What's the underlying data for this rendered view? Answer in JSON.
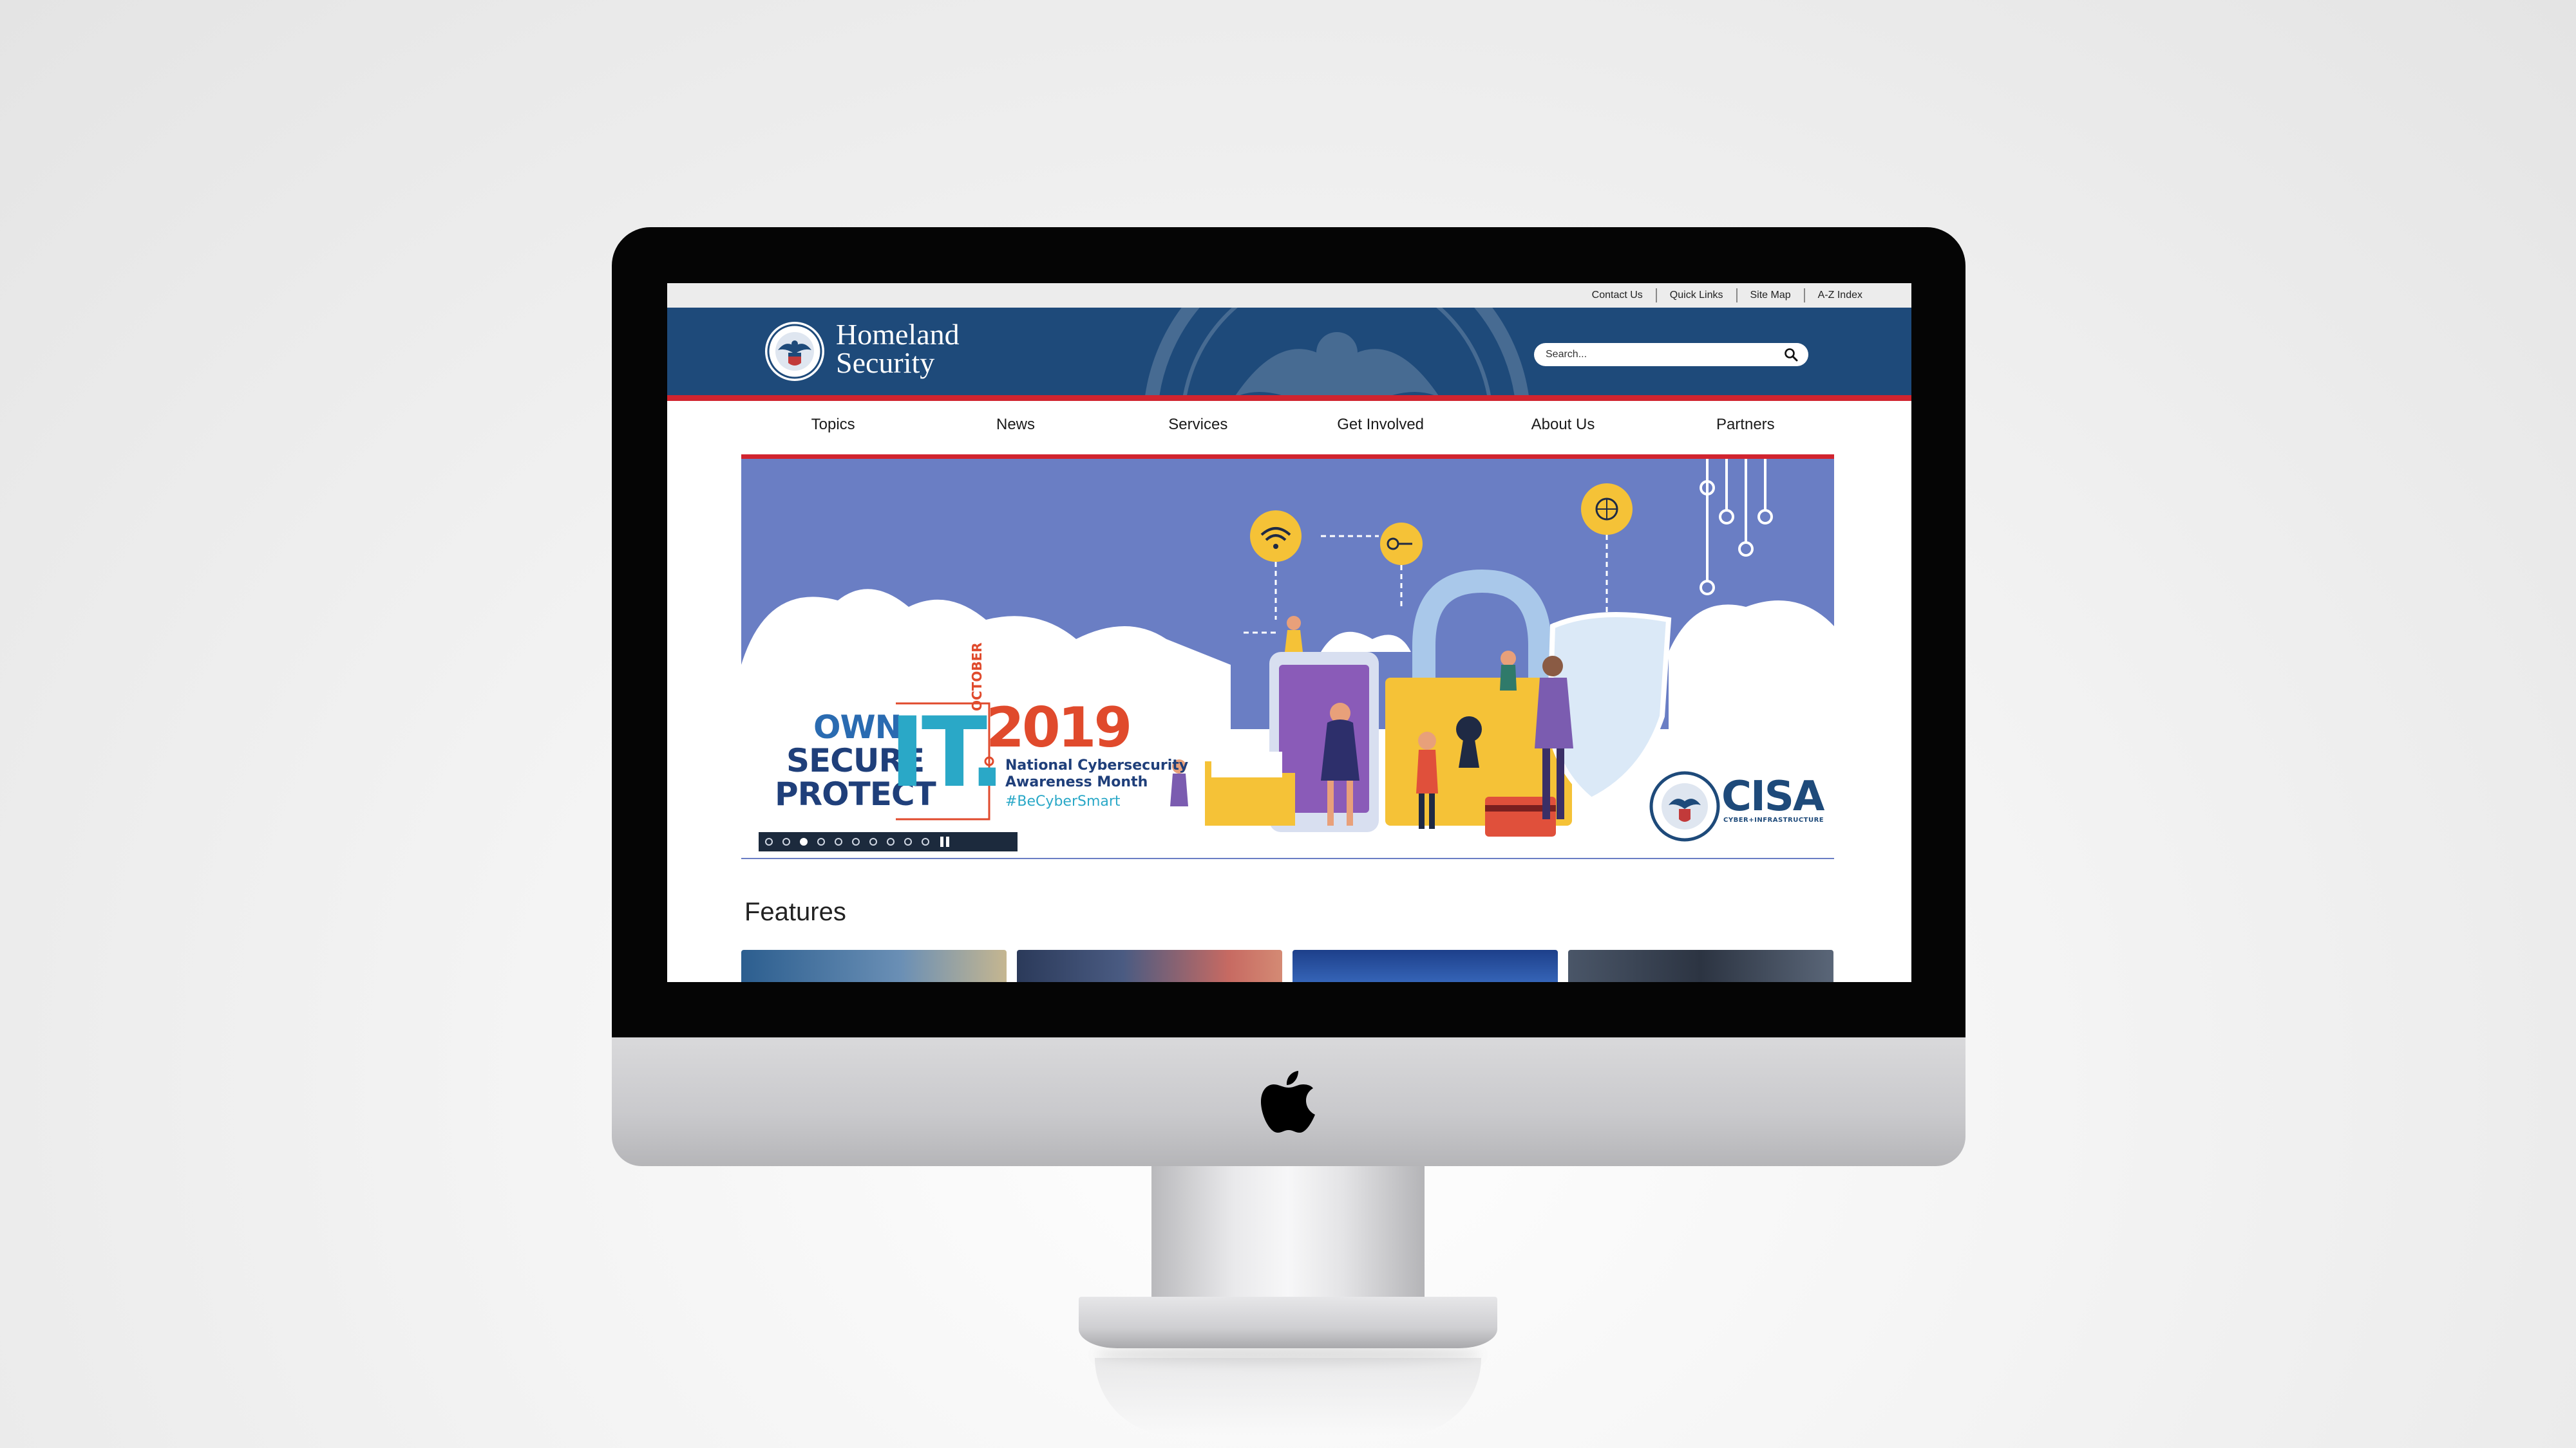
{
  "utility_links": [
    "Contact Us",
    "Quick Links",
    "Site Map",
    "A-Z Index"
  ],
  "brand": {
    "line1": "Homeland",
    "line2": "Security"
  },
  "search": {
    "placeholder": "Search..."
  },
  "nav": [
    "Topics",
    "News",
    "Services",
    "Get Involved",
    "About Us",
    "Partners"
  ],
  "hero": {
    "own": "OWN",
    "secure": "SECURE",
    "protect": "PROTECT",
    "it": "IT.",
    "october": "OCTOBER",
    "year": "2019",
    "line1": "National Cybersecurity",
    "line2": "Awareness Month",
    "hashtag": "#BeCyberSmart",
    "cisa": "CISA",
    "cisa_sub": "CYBER+INFRASTRUCTURE"
  },
  "carousel": {
    "slide_count": 10,
    "active_index": 2
  },
  "features": {
    "title": "Features"
  },
  "colors": {
    "header_blue": "#1e4a7a",
    "accent_red": "#d1242f",
    "hero_blue": "#6a7ec4",
    "lock_yellow": "#f5c237"
  }
}
